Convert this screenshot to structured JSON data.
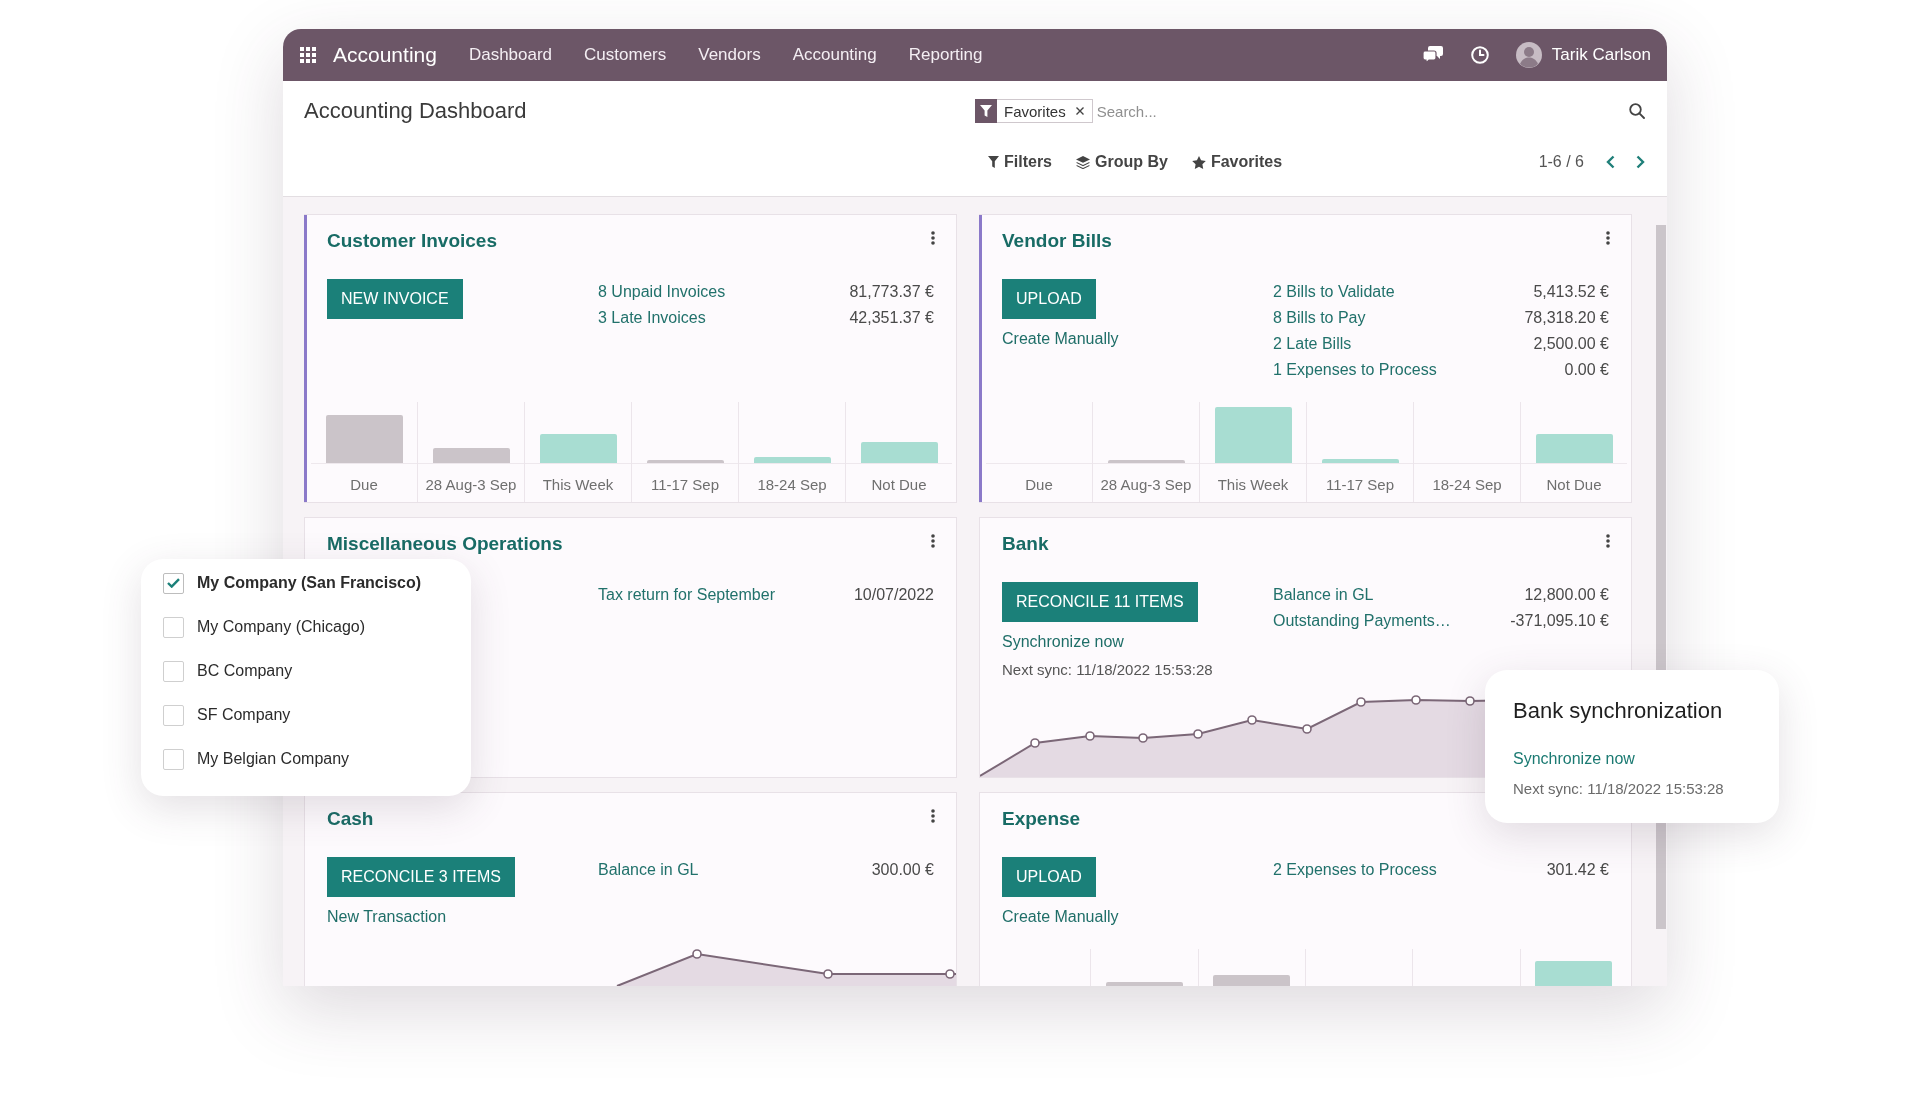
{
  "navbar": {
    "app_name": "Accounting",
    "menu": [
      "Dashboard",
      "Customers",
      "Vendors",
      "Accounting",
      "Reporting"
    ],
    "user": "Tarik Carlson"
  },
  "control_panel": {
    "title": "Accounting Dashboard",
    "search": {
      "facet": "Favorites",
      "placeholder": "Search..."
    },
    "toolbar": [
      {
        "kind": "filter",
        "label": "Filters"
      },
      {
        "kind": "group",
        "label": "Group By"
      },
      {
        "kind": "favorite",
        "label": "Favorites"
      }
    ],
    "pager": "1-6 / 6"
  },
  "cards": [
    {
      "title": "Customer Invoices",
      "color": "#8b79c9",
      "menu": true,
      "actions": [
        {
          "kind": "button",
          "label": "NEW INVOICE"
        }
      ],
      "stats": [
        {
          "label": "8 Unpaid Invoices",
          "value": "81,773.37 €"
        },
        {
          "label": "3 Late Invoices",
          "value": "42,351.37 €"
        }
      ],
      "chart": {
        "kind": "bar",
        "labels": [
          "Due",
          "28 Aug-3 Sep",
          "This Week",
          "11-17 Sep",
          "18-24 Sep",
          "Not Due"
        ]
      }
    },
    {
      "title": "Vendor Bills",
      "color": "#8b79c9",
      "menu": true,
      "actions": [
        {
          "kind": "button",
          "label": "UPLOAD"
        },
        {
          "kind": "link",
          "label": "Create Manually"
        }
      ],
      "stats": [
        {
          "label": "2 Bills to Validate",
          "value": "5,413.52 €"
        },
        {
          "label": "8 Bills to Pay",
          "value": "78,318.20 €"
        },
        {
          "label": "2 Late Bills",
          "value": "2,500.00 €"
        },
        {
          "label": "1 Expenses to Process",
          "value": "0.00 €"
        }
      ],
      "chart": {
        "kind": "bar",
        "labels": [
          "Due",
          "28 Aug-3 Sep",
          "This Week",
          "11-17 Sep",
          "18-24 Sep",
          "Not Due"
        ]
      }
    },
    {
      "title": "Miscellaneous Operations",
      "menu": true,
      "stats": [
        {
          "label": "Tax return for September",
          "value": "10/07/2022"
        }
      ]
    },
    {
      "title": "Bank",
      "menu": true,
      "actions": [
        {
          "kind": "button",
          "label": "RECONCILE 11 ITEMS"
        },
        {
          "kind": "link",
          "label": "Synchronize now"
        },
        {
          "kind": "note",
          "label": "Next sync: 11/18/2022 15:53:28"
        }
      ],
      "stats": [
        {
          "label": "Balance in GL",
          "value": "12,800.00 €"
        },
        {
          "label": "Outstanding Payments…",
          "value": "-371,095.10 €"
        }
      ],
      "chart": {
        "kind": "line"
      }
    },
    {
      "title": "Cash",
      "menu": true,
      "actions": [
        {
          "kind": "button",
          "label": "RECONCILE 3 ITEMS"
        },
        {
          "kind": "link",
          "label": "New Transaction"
        }
      ],
      "stats": [
        {
          "label": "Balance in GL",
          "value": "300.00 €"
        }
      ],
      "chart": {
        "kind": "line"
      }
    },
    {
      "title": "Expense",
      "actions": [
        {
          "kind": "button",
          "label": "UPLOAD"
        },
        {
          "kind": "link",
          "label": "Create Manually"
        }
      ],
      "stats": [
        {
          "label": "2 Expenses to Process",
          "value": "301.42 €"
        }
      ],
      "chart": {
        "kind": "bar"
      }
    }
  ],
  "company_switcher": [
    {
      "label": "My Company (San Francisco)",
      "checked": true
    },
    {
      "label": "My Company (Chicago)",
      "checked": false
    },
    {
      "label": "BC Company",
      "checked": false
    },
    {
      "label": "SF Company",
      "checked": false
    },
    {
      "label": "My Belgian Company",
      "checked": false
    }
  ],
  "sync_tooltip": {
    "title": "Bank synchronization",
    "link": "Synchronize now",
    "note": "Next sync: 11/18/2022 15:53:28"
  }
}
